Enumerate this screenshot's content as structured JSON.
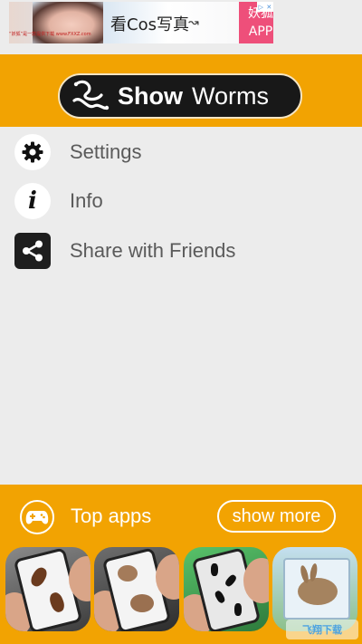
{
  "ad": {
    "small_text": "“妖狐”是一款提供下载 www.FXXZ.com",
    "text": "看Cos写真",
    "app_line1": "妖狐",
    "app_line2": "APP"
  },
  "header": {
    "button_bold": "Show",
    "button_rest": "Worms"
  },
  "menu": [
    {
      "label": "Settings",
      "icon": "gear-icon"
    },
    {
      "label": "Info",
      "icon": "info-icon"
    },
    {
      "label": "Share with Friends",
      "icon": "share-icon"
    }
  ],
  "footer": {
    "title": "Top apps",
    "show_more": "show more",
    "apps": [
      {
        "name": "cockroach-app"
      },
      {
        "name": "mouse-app"
      },
      {
        "name": "ants-app"
      },
      {
        "name": "rabbit-app"
      }
    ],
    "watermark": "飞翔下载"
  },
  "colors": {
    "accent": "#f2a302",
    "background": "#ececec",
    "button": "#181818"
  }
}
